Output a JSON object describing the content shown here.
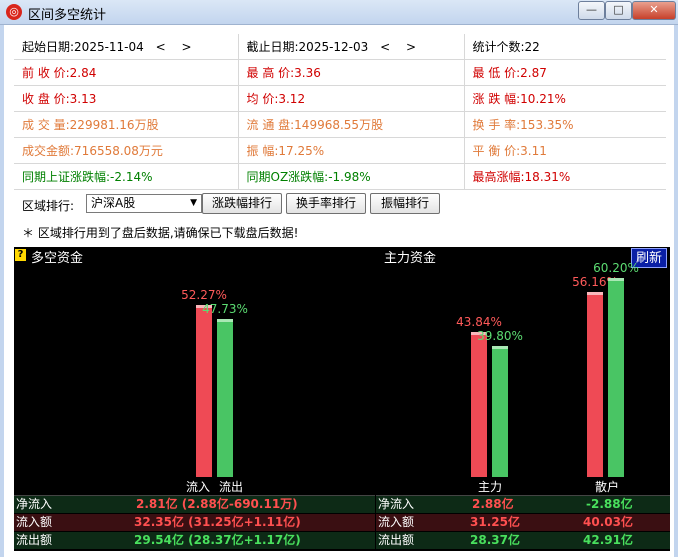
{
  "window": {
    "title": "区间多空统计",
    "min_label": "—",
    "max_label": "□",
    "close_label": "✕"
  },
  "stats": {
    "start_date": "起始日期:2025-11-04",
    "end_date": "截止日期:2025-12-03",
    "date_arrows": "< >",
    "stat_count": "统计个数:22",
    "prev_close": "前 收 价:2.84",
    "high": "最 高 价:3.36",
    "low": "最 低 价:2.87",
    "close": "收 盘 价:3.13",
    "avg": "均    价:3.12",
    "change": "涨 跌 幅:10.21%",
    "volume": "成 交 量:229981.16万股",
    "float": "流 通 盘:149968.55万股",
    "turnover": "换 手 率:153.35%",
    "amount": "成交金额:716558.08万元",
    "amplitude": "振    幅:17.25%",
    "balance": "平 衡 价:3.11",
    "sh_change": "同期上证涨跌幅:-2.14%",
    "oz_change": "同期OZ涨跌幅:-1.98%",
    "max_change": "最高涨幅:18.31%"
  },
  "region": {
    "label": "区域排行:",
    "selected": "沪深A股",
    "buttons": [
      "涨跌幅排行",
      "换手率排行",
      "振幅排行"
    ]
  },
  "note": "＊ 区域排行用到了盘后数据,请确保已下载盘后数据!",
  "panel": {
    "left_title": "多空资金",
    "right_title": "主力资金",
    "help_icon": "?",
    "refresh_label": "刷新"
  },
  "chart_data": [
    {
      "type": "bar",
      "title": "多空资金",
      "categories": [
        "流入",
        "流出"
      ],
      "values": [
        52.27,
        47.73
      ],
      "labels": [
        "52.27%",
        "47.73%"
      ],
      "colors": [
        "#ef4a55",
        "#49c564"
      ]
    },
    {
      "type": "bar",
      "title": "主力资金",
      "categories": [
        "主力",
        "散户"
      ],
      "series": [
        {
          "values": [
            43.84,
            56.16
          ],
          "labels": [
            "43.84%",
            "56.16%"
          ],
          "color": "#ef4a55"
        },
        {
          "values": [
            39.8,
            60.2
          ],
          "labels": [
            "39.80%",
            "60.20%"
          ],
          "color": "#49c564"
        }
      ]
    }
  ],
  "table_left": [
    {
      "key": "净流入",
      "value": "2.81亿 (2.88亿-690.11万)",
      "color": "#ff5050"
    },
    {
      "key": "流入额",
      "value": "32.35亿 (31.25亿+1.11亿)",
      "color": "#ff5050"
    },
    {
      "key": "流出额",
      "value": "29.54亿 (28.37亿+1.17亿)",
      "color": "#49e05d"
    }
  ],
  "table_right": [
    {
      "key": "净流入",
      "v1": "2.88亿",
      "v2": "-2.88亿",
      "c1": "#ff5050",
      "c2": "#49e05d"
    },
    {
      "key": "流入额",
      "v1": "31.25亿",
      "v2": "40.03亿",
      "c1": "#ff5050",
      "c2": "#ff5050"
    },
    {
      "key": "流出额",
      "v1": "28.37亿",
      "v2": "42.91亿",
      "c1": "#49e05d",
      "c2": "#49e05d"
    }
  ]
}
